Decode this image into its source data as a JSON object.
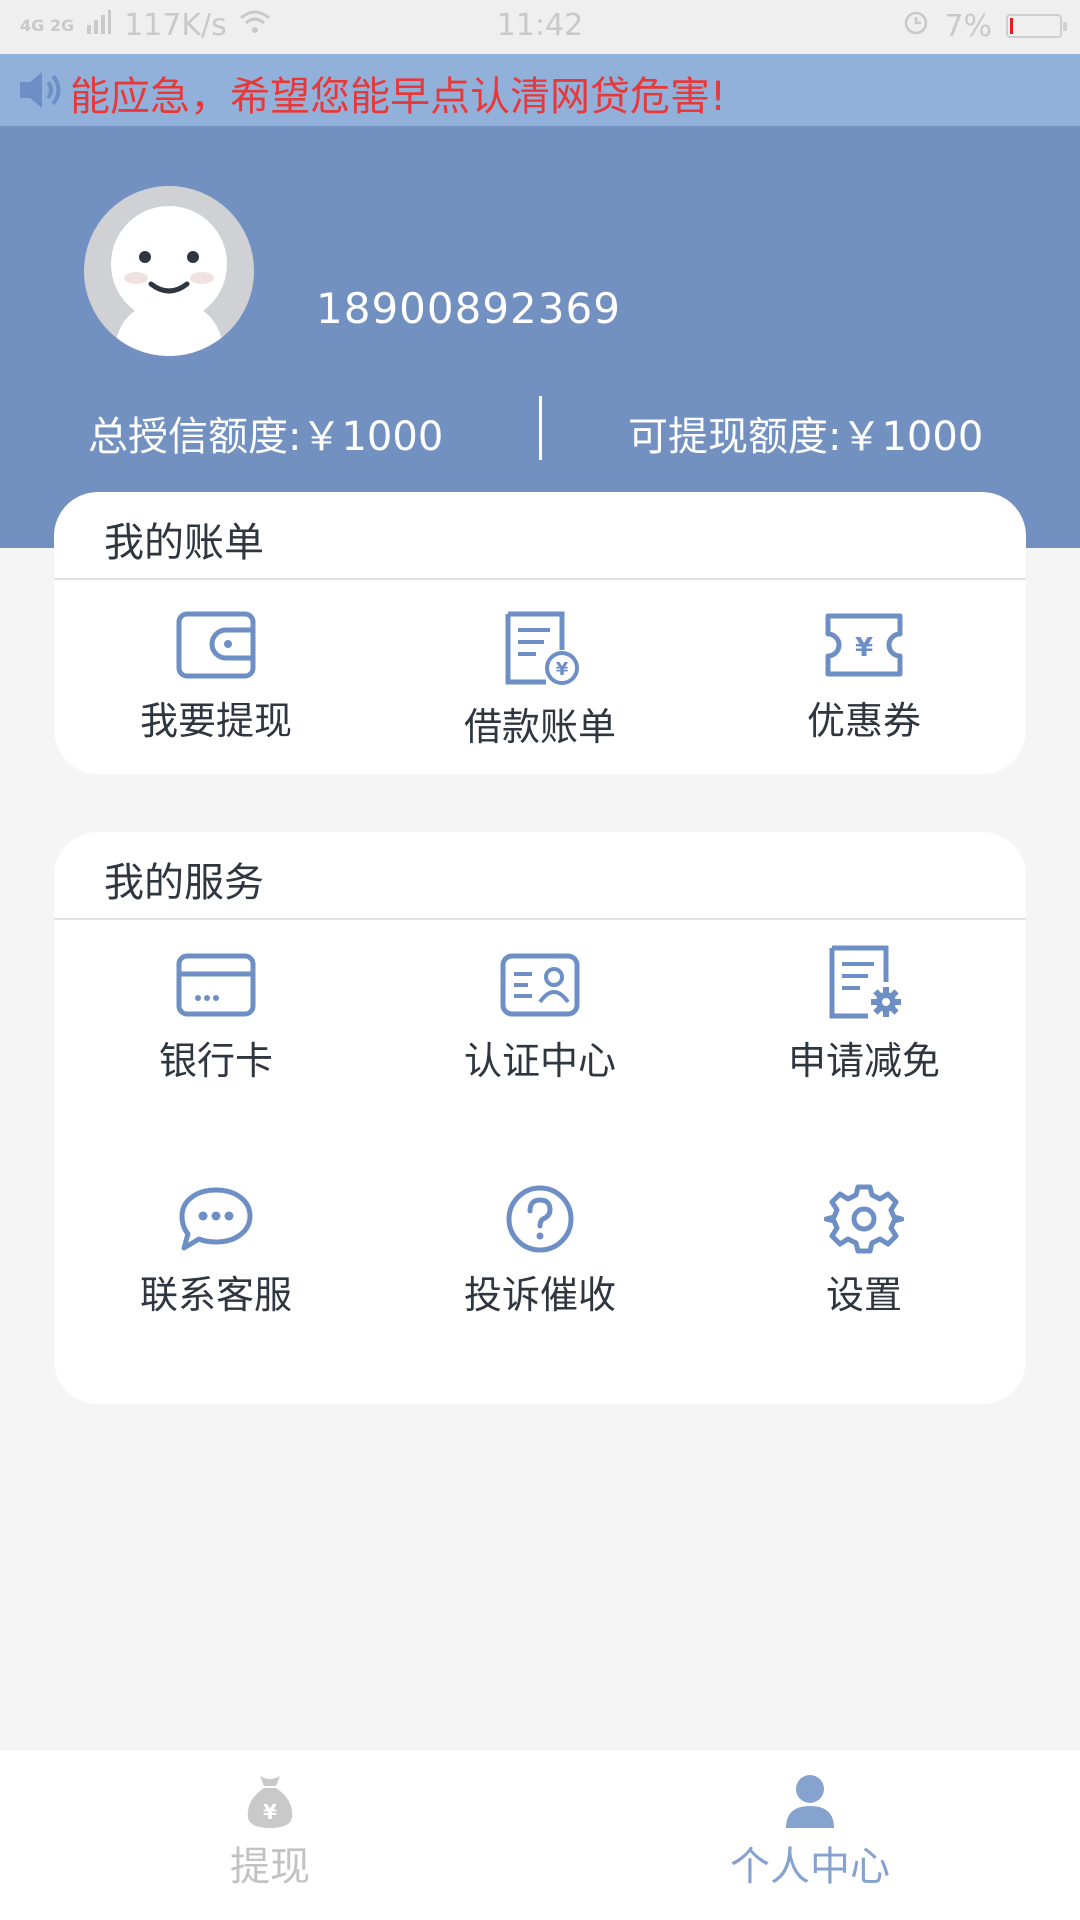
{
  "status_bar": {
    "network": "4G 2G",
    "speed": "117K/s",
    "time": "11:42",
    "battery": "7%",
    "battery_level": 0.07
  },
  "notice": {
    "text": "能应急，希望您能早点认清网贷危害!",
    "color": "#e8393a"
  },
  "profile": {
    "phone": "18900892369",
    "total_credit": "总授信额度:￥1000",
    "available_withdraw": "可提现额度:￥1000"
  },
  "bills": {
    "title": "我的账单",
    "items": [
      {
        "label": "我要提现",
        "icon": "wallet-icon"
      },
      {
        "label": "借款账单",
        "icon": "bill-document-icon"
      },
      {
        "label": "优惠券",
        "icon": "coupon-icon"
      }
    ]
  },
  "services": {
    "title": "我的服务",
    "items": [
      {
        "label": "银行卡",
        "icon": "bank-card-icon"
      },
      {
        "label": "认证中心",
        "icon": "id-card-icon"
      },
      {
        "label": "申请减免",
        "icon": "document-settings-icon"
      },
      {
        "label": "联系客服",
        "icon": "chat-bubble-icon"
      },
      {
        "label": "投诉催收",
        "icon": "question-circle-icon"
      },
      {
        "label": "设置",
        "icon": "gear-icon"
      }
    ]
  },
  "tabbar": {
    "tabs": [
      {
        "label": "提现",
        "icon": "money-bag-icon",
        "active": false
      },
      {
        "label": "个人中心",
        "icon": "person-icon",
        "active": true
      }
    ]
  },
  "colors": {
    "header": "#7391c0",
    "notice_bg": "#91b1db",
    "icon_blue": "#6d8fc6",
    "tab_active": "#86a2cf",
    "tab_inactive": "#c2c2c2"
  }
}
